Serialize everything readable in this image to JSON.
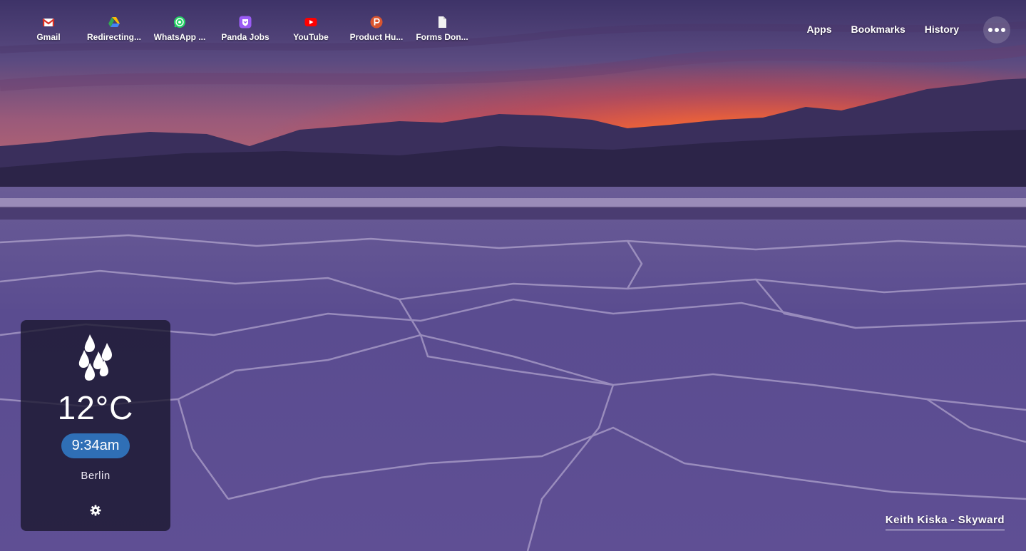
{
  "shortcuts": [
    {
      "label": "Gmail",
      "icon": "gmail-icon"
    },
    {
      "label": "Redirecting...",
      "icon": "google-drive-icon"
    },
    {
      "label": "WhatsApp ...",
      "icon": "whatsapp-icon"
    },
    {
      "label": "Panda Jobs",
      "icon": "panda-icon"
    },
    {
      "label": "YouTube",
      "icon": "youtube-icon"
    },
    {
      "label": "Product Hu...",
      "icon": "product-hunt-icon"
    },
    {
      "label": "Forms Don...",
      "icon": "document-icon"
    }
  ],
  "nav": {
    "apps": "Apps",
    "bookmarks": "Bookmarks",
    "history": "History"
  },
  "menu": {
    "icon": "more-dots-icon"
  },
  "weather": {
    "icon": "rain-icon",
    "temperature": "12°C",
    "time": "9:34am",
    "city": "Berlin",
    "settings_icon": "gear-icon"
  },
  "credit": "Keith Kiska - Skyward",
  "colors": {
    "time_pill": "#2f6fb6",
    "panel": "#18162c"
  }
}
